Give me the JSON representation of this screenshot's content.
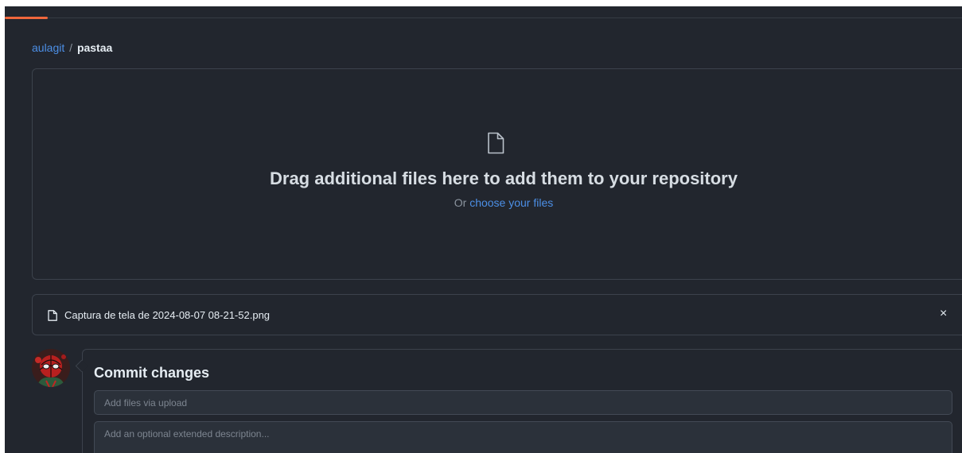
{
  "breadcrumb": {
    "owner": "aulagit",
    "separator": "/",
    "repo": "pastaa"
  },
  "dropzone": {
    "icon": "file-icon",
    "title": "Drag additional files here to add them to your repository",
    "sub_prefix": "Or",
    "sub_link": "choose your files"
  },
  "file": {
    "icon": "file-icon",
    "name": "Captura de tela de 2024-08-07 08-21-52.png",
    "remove": "×"
  },
  "commit": {
    "avatar": "avatar-spiderman",
    "title": "Commit changes",
    "summary_placeholder": "Add files via upload",
    "description_placeholder": "Add an optional extended description..."
  },
  "colors": {
    "background": "#22262e",
    "border": "#3c424c",
    "link": "#4c8fe6",
    "accent": "#f0673c"
  }
}
